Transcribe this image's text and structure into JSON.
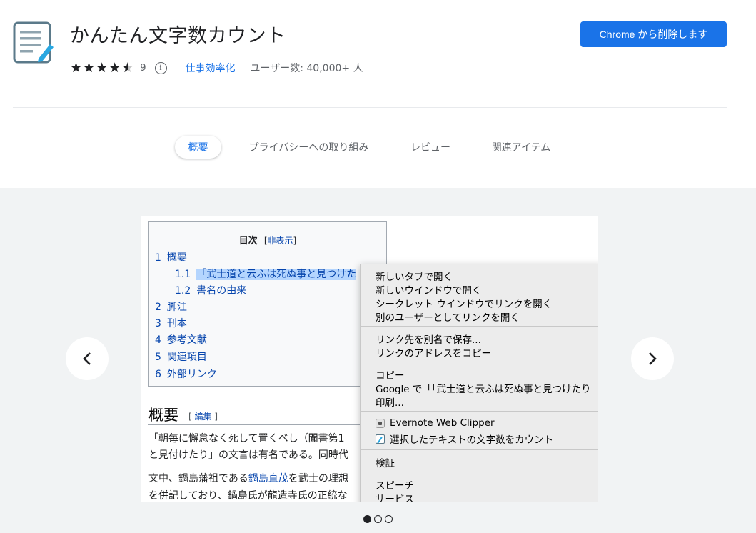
{
  "extension": {
    "title": "かんたん文字数カウント",
    "rating_count": "9",
    "category": "仕事効率化",
    "users": "ユーザー数: 40,000+ 人",
    "remove_button": "Chrome から削除します",
    "info_icon": "i",
    "star_glyph": "★"
  },
  "tabs": [
    {
      "label": "概要"
    },
    {
      "label": "プライバシーへの取り組み"
    },
    {
      "label": "レビュー"
    },
    {
      "label": "関連アイテム"
    }
  ],
  "gallery": {
    "prev": "‹",
    "next": "›"
  },
  "screenshot": {
    "toc": {
      "title": "目次",
      "hide_open": "[",
      "hide_label": "非表示",
      "hide_close": "]",
      "items": [
        {
          "num": "1",
          "label": "概要"
        },
        {
          "num": "1.1",
          "label": "「武士道と云ふは死ぬ事と見つけた"
        },
        {
          "num": "1.2",
          "label": "書名の由来"
        },
        {
          "num": "2",
          "label": "脚注"
        },
        {
          "num": "3",
          "label": "刊本"
        },
        {
          "num": "4",
          "label": "参考文献"
        },
        {
          "num": "5",
          "label": "関連項目"
        },
        {
          "num": "6",
          "label": "外部リンク"
        }
      ]
    },
    "section": {
      "heading": "概要",
      "edit_open": "[ ",
      "edit_label": "編集",
      "edit_close": " ]"
    },
    "paragraphs": {
      "line1": "「朝毎に懈怠なく死して置くべし（聞書第1",
      "line2": "と見付けたり」の文言は有名である。同時代",
      "line3_pre": "文中、鍋島藩祖である",
      "line3_link": "鍋島直茂",
      "line3_post": "を武士の理想",
      "line4": "を併記しており、鍋島氏が龍造寺氏の正統な"
    },
    "context_menu": {
      "group1": [
        "新しいタブで開く",
        "新しいウインドウで開く",
        "シークレット ウインドウでリンクを開く",
        "別のユーザーとしてリンクを開く"
      ],
      "group2": [
        "リンク先を別名で保存...",
        "リンクのアドレスをコピー"
      ],
      "group3": [
        "コピー",
        "Google で「「武士道と云ふは死ぬ事と見つけたり",
        "印刷..."
      ],
      "group4": [
        {
          "label": "Evernote Web Clipper",
          "icon": "evernote-icon"
        },
        {
          "label": "選択したテキストの文字数をカウント",
          "icon": "char-count-icon"
        }
      ],
      "group5": [
        "検証"
      ],
      "group6": [
        "スピーチ",
        "サービス"
      ]
    }
  },
  "colors": {
    "accent": "#1a73e8",
    "gallery_bg": "#f1f3f4",
    "link": "#0645ad",
    "selection": "#b4d5fe"
  }
}
